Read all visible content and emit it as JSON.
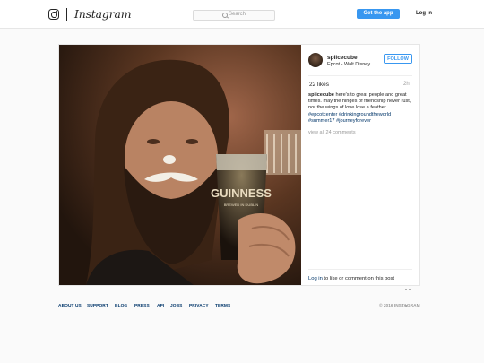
{
  "header": {
    "wordmark": "Instagram",
    "search_placeholder": "Search",
    "get_app_label": "Get the app",
    "login_label": "Log in"
  },
  "post": {
    "username": "splicecube",
    "location": "Epcot - Walt Disney...",
    "follow_label": "FOLLOW",
    "likes": "22 likes",
    "time": "2h",
    "caption_username": "splicecube",
    "caption_text": "here's to great people and great times. may the hinges of friendship never rust, nor the wings of love lose a feather.",
    "hashtags": [
      "#epcotcenter",
      "#drinkingroundtheworld",
      "#summer17",
      "#journeyforever"
    ],
    "view_comments": "view all 24 comments",
    "login_link": "Log in",
    "comment_prompt": "to like or comment on this post",
    "photo": {
      "glass_text": "GUINNESS",
      "glass_subtext": "BREWED IN DUBLIN",
      "colors": {
        "background": "#3a2a20",
        "skin": "#b98363",
        "beard": "#2a1a10",
        "beer": "#120c08"
      }
    }
  },
  "footer": {
    "links": [
      "ABOUT US",
      "SUPPORT",
      "BLOG",
      "PRESS",
      "API",
      "JOBS",
      "PRIVACY",
      "TERMS"
    ],
    "copyright": "© 2016 INSTAGRAM"
  },
  "colors": {
    "accent": "#3897f0",
    "link": "#003569",
    "muted": "#999999"
  }
}
